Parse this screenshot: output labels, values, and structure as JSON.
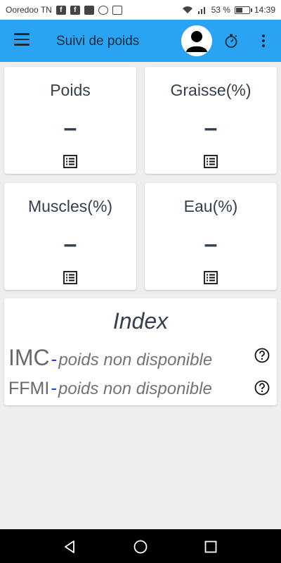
{
  "status_bar": {
    "carrier": "Ooredoo TN",
    "battery_percent": "53 %",
    "battery_level": 0.53,
    "time": "14:39",
    "icons": [
      "facebook-icon",
      "facebook-icon",
      "sd-card-icon",
      "chat-icon",
      "image-icon",
      "wifi-icon",
      "signal-icon",
      "battery-icon"
    ]
  },
  "app_bar": {
    "title": "Suivi de poids",
    "color": "#29a3f2",
    "icons": [
      "menu-icon",
      "avatar-icon",
      "stopwatch-icon",
      "more-vert-icon"
    ]
  },
  "metrics": [
    {
      "title": "Poids",
      "value": "–"
    },
    {
      "title": "Graisse(%)",
      "value": "–"
    },
    {
      "title": "Muscles(%)",
      "value": "–"
    },
    {
      "title": "Eau(%)",
      "value": "–"
    }
  ],
  "index": {
    "title": "Index",
    "rows": [
      {
        "label": "IMC",
        "dash": "-",
        "text": "poids non disponible"
      },
      {
        "label": "FFMI",
        "dash": "-",
        "text": "poids non disponible"
      }
    ]
  },
  "nav_bar": {
    "icons": [
      "back-icon",
      "home-icon",
      "recents-icon"
    ]
  }
}
